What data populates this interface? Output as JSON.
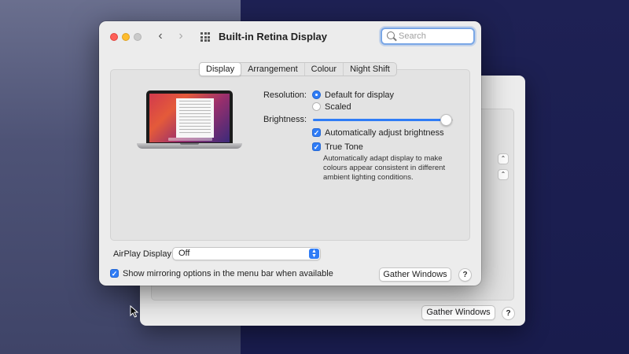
{
  "window": {
    "title": "Built-in Retina Display",
    "search_placeholder": "Search",
    "nav": {
      "back": "‹",
      "forward": "›"
    }
  },
  "tabs": [
    {
      "label": "Display",
      "active": true
    },
    {
      "label": "Arrangement",
      "active": false
    },
    {
      "label": "Colour",
      "active": false
    },
    {
      "label": "Night Shift",
      "active": false
    }
  ],
  "display": {
    "resolution_label": "Resolution:",
    "resolution_options": [
      {
        "label": "Default for display",
        "selected": true
      },
      {
        "label": "Scaled",
        "selected": false
      }
    ],
    "brightness_label": "Brightness:",
    "brightness_level": 0.95,
    "auto_brightness": {
      "label": "Automatically adjust brightness",
      "checked": true
    },
    "true_tone": {
      "label": "True Tone",
      "checked": true,
      "description": "Automatically adapt display to make colours appear consistent in different ambient lighting conditions."
    }
  },
  "airplay": {
    "label": "AirPlay Display:",
    "value": "Off"
  },
  "mirroring": {
    "label": "Show mirroring options in the menu bar when available",
    "checked": true
  },
  "buttons": {
    "gather_windows": "Gather Windows",
    "help": "?"
  },
  "back_window": {
    "gather_windows": "Gather Windows",
    "help": "?"
  },
  "colors": {
    "accent": "#2f7cf6",
    "close": "#fe5f57",
    "minimize": "#febc2e",
    "zoom_disabled": "#cacaca"
  }
}
